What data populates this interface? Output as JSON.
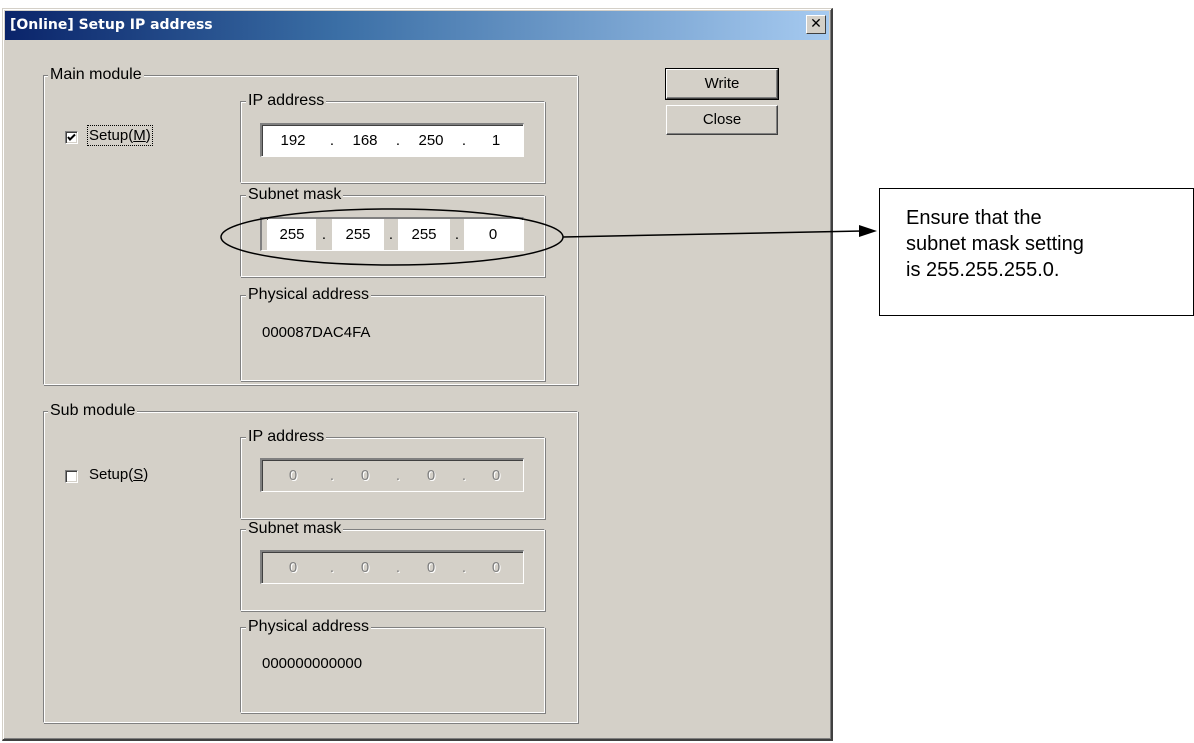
{
  "window": {
    "title": "[Online] Setup IP address",
    "close_glyph": "✕"
  },
  "buttons": {
    "write": "Write",
    "close": "Close"
  },
  "main_module": {
    "label": "Main module",
    "setup": {
      "prefix": "Setup(",
      "mnemonic": "M",
      "suffix": ")",
      "checked": true
    },
    "ip": {
      "label": "IP address",
      "octets": [
        "192",
        "168",
        "250",
        "1"
      ]
    },
    "subnet": {
      "label": "Subnet mask",
      "octets": [
        "255",
        "255",
        "255",
        "0"
      ]
    },
    "physical": {
      "label": "Physical address",
      "value": "000087DAC4FA"
    }
  },
  "sub_module": {
    "label": "Sub module",
    "setup": {
      "prefix": "Setup(",
      "mnemonic": "S",
      "suffix": ")",
      "checked": false
    },
    "ip": {
      "label": "IP address",
      "octets": [
        "0",
        "0",
        "0",
        "0"
      ]
    },
    "subnet": {
      "label": "Subnet mask",
      "octets": [
        "0",
        "0",
        "0",
        "0"
      ]
    },
    "physical": {
      "label": "Physical address",
      "value": "000000000000"
    }
  },
  "callout": {
    "lines": [
      "Ensure that the",
      "subnet mask setting",
      "is 255.255.255.0."
    ]
  },
  "separator": "."
}
